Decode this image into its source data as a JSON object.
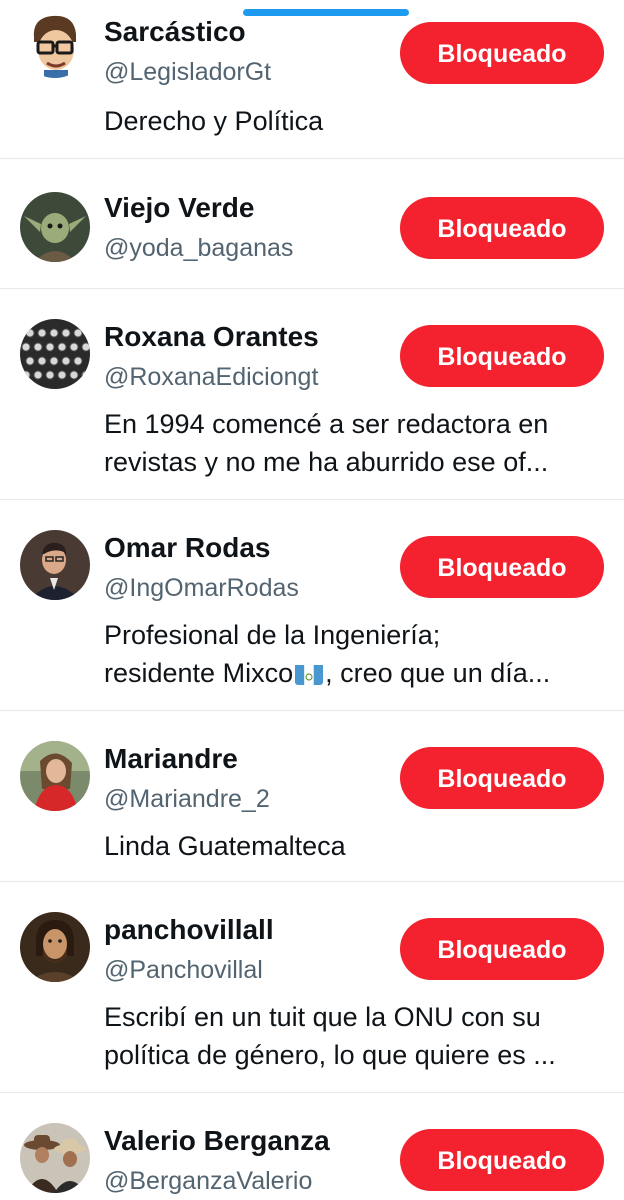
{
  "users": [
    {
      "name": "Sarcástico",
      "handle": "@LegisladorGt",
      "button_label": "Bloqueado",
      "bio": [
        "Derecho y Política"
      ],
      "avatar": "cartoon-man-glasses-avatar"
    },
    {
      "name": "Viejo Verde",
      "handle": "@yoda_baganas",
      "button_label": "Bloqueado",
      "bio": [],
      "avatar": "yoda-avatar"
    },
    {
      "name": "Roxana Orantes",
      "handle": "@RoxanaEdiciongt",
      "button_label": "Bloqueado",
      "bio": [
        "En 1994 comencé a ser redactora en",
        "revistas y no me ha aburrido ese of..."
      ],
      "avatar": "typewriter-avatar"
    },
    {
      "name": "Omar Rodas",
      "handle": "@IngOmarRodas",
      "button_label": "Bloqueado",
      "bio": [
        "Profesional de la Ingeniería;",
        "residente Mixco",
        ", creo que un día..."
      ],
      "avatar": "man-portrait-avatar",
      "bio_icon": "guatemala-flag-icon"
    },
    {
      "name": "Mariandre",
      "handle": "@Mariandre_2",
      "button_label": "Bloqueado",
      "bio": [
        "Linda Guatemalteca"
      ],
      "avatar": "woman-red-top-avatar"
    },
    {
      "name": "panchovillall",
      "handle": "@Panchovillal",
      "button_label": "Bloqueado",
      "bio": [
        "Escribí en un tuit que la ONU con su",
        "política de género, lo que quiere es ..."
      ],
      "avatar": "bearded-man-painting-avatar"
    },
    {
      "name": "Valerio Berganza",
      "handle": "@BerganzaValerio",
      "button_label": "Bloqueado",
      "bio": [],
      "avatar": "cowboys-avatar"
    }
  ],
  "colors": {
    "accent_blue": "#1d9bf0",
    "blocked_red": "#f4212e",
    "handle_gray": "#536471",
    "divider": "#e6e9eb"
  }
}
